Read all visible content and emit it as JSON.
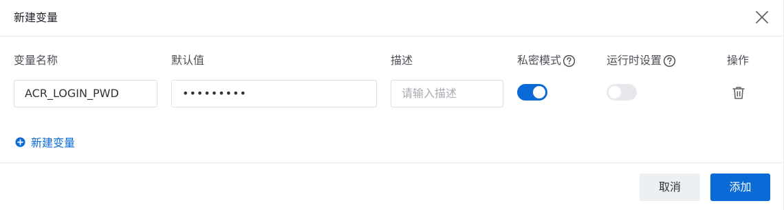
{
  "dialog": {
    "title": "新建变量",
    "close_icon": "close-icon"
  },
  "columns": {
    "name": "变量名称",
    "default_value": "默认值",
    "description": "描述",
    "private_mode": "私密模式",
    "runtime_setting": "运行时设置",
    "actions": "操作"
  },
  "row": {
    "name_value": "ACR_LOGIN_PWD",
    "default_value_masked": "•••••••••",
    "description_placeholder": "请输入描述",
    "private_mode_on": true,
    "runtime_setting_on": false
  },
  "add_variable": {
    "label": "新建变量",
    "icon": "plus-circle-icon"
  },
  "footer": {
    "cancel_label": "取消",
    "submit_label": "添加"
  },
  "colors": {
    "primary": "#0a6ad6",
    "toggle_off": "#e6e8eb",
    "cancel_bg": "#edf0f3",
    "border": "#dcdfe6"
  }
}
